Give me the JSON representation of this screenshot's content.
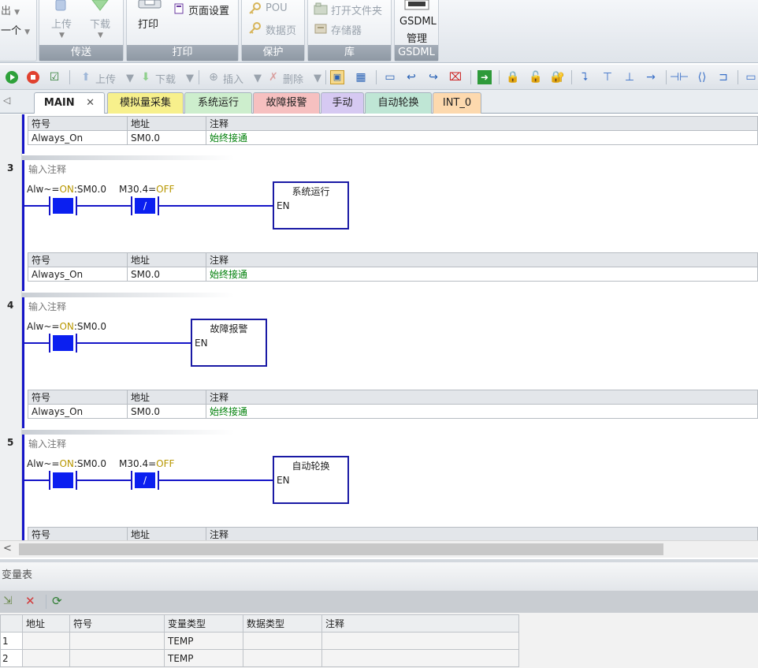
{
  "ribbon": {
    "partial_top_left": "出",
    "partial_mid_left": "一个",
    "upload_label": "上传",
    "download_label": "下载",
    "print_label": "打印",
    "page_setup_label": "页面设置",
    "pou_label": "POU",
    "data_page_label": "数据页",
    "open_folder_label": "打开文件夹",
    "memory_label": "存储器",
    "gsdml_line1": "GSDML",
    "gsdml_line2": "管理",
    "groups": {
      "transfer": "传送",
      "print": "打印",
      "protect": "保护",
      "library": "库",
      "gsdml": "GSDML"
    }
  },
  "toolbar": {
    "upload": "上传",
    "download": "下载",
    "insert": "插入",
    "delete": "删除"
  },
  "tabs": [
    {
      "label": "MAIN",
      "color": "#ffffff",
      "active": true,
      "close": "✕"
    },
    {
      "label": "模拟量采集",
      "color": "#f7f08c"
    },
    {
      "label": "系统运行",
      "color": "#cdeecd"
    },
    {
      "label": "故障报警",
      "color": "#f6c0c0"
    },
    {
      "label": "手动",
      "color": "#d6c9f2"
    },
    {
      "label": "自动轮换",
      "color": "#bfe6d5"
    },
    {
      "label": "INT_0",
      "color": "#fdd9ae"
    }
  ],
  "symbol_headers": {
    "symbol": "符号",
    "address": "地址",
    "comment": "注释"
  },
  "top_symbol_row": {
    "symbol": "Always_On",
    "address": "SM0.0",
    "comment": "始终接通"
  },
  "networks": [
    {
      "number": "3",
      "comment": "输入注释",
      "contact1": {
        "label_prefix": "Alw~=",
        "state": "ON",
        "label_suffix": ":SM0.0"
      },
      "contact2": {
        "label_prefix": "M30.4=",
        "state": "OFF",
        "symbol": "/"
      },
      "box_title": "系统运行",
      "box_input": "EN",
      "row": {
        "symbol": "Always_On",
        "address": "SM0.0",
        "comment": "始终接通"
      }
    },
    {
      "number": "4",
      "comment": "输入注释",
      "contact1": {
        "label_prefix": "Alw~=",
        "state": "ON",
        "label_suffix": ":SM0.0"
      },
      "box_title": "故障报警",
      "box_input": "EN",
      "row": {
        "symbol": "Always_On",
        "address": "SM0.0",
        "comment": "始终接通"
      }
    },
    {
      "number": "5",
      "comment": "输入注释",
      "contact1": {
        "label_prefix": "Alw~=",
        "state": "ON",
        "label_suffix": ":SM0.0"
      },
      "contact2": {
        "label_prefix": "M30.4=",
        "state": "OFF",
        "symbol": "/"
      },
      "box_title": "自动轮换",
      "box_input": "EN"
    }
  ],
  "var_table": {
    "title": "变量表",
    "headers": [
      "",
      "地址",
      "符号",
      "变量类型",
      "数据类型",
      "注释"
    ],
    "rows": [
      {
        "n": "1",
        "address": "",
        "symbol": "",
        "var_type": "TEMP",
        "data_type": "",
        "comment": ""
      },
      {
        "n": "2",
        "address": "",
        "symbol": "",
        "var_type": "TEMP",
        "data_type": "",
        "comment": ""
      }
    ]
  },
  "colors": {
    "wire": "#1515c8",
    "contact_fill": "#0b1ff0",
    "on_state": "#b89700",
    "comment_green": "#00800a"
  }
}
